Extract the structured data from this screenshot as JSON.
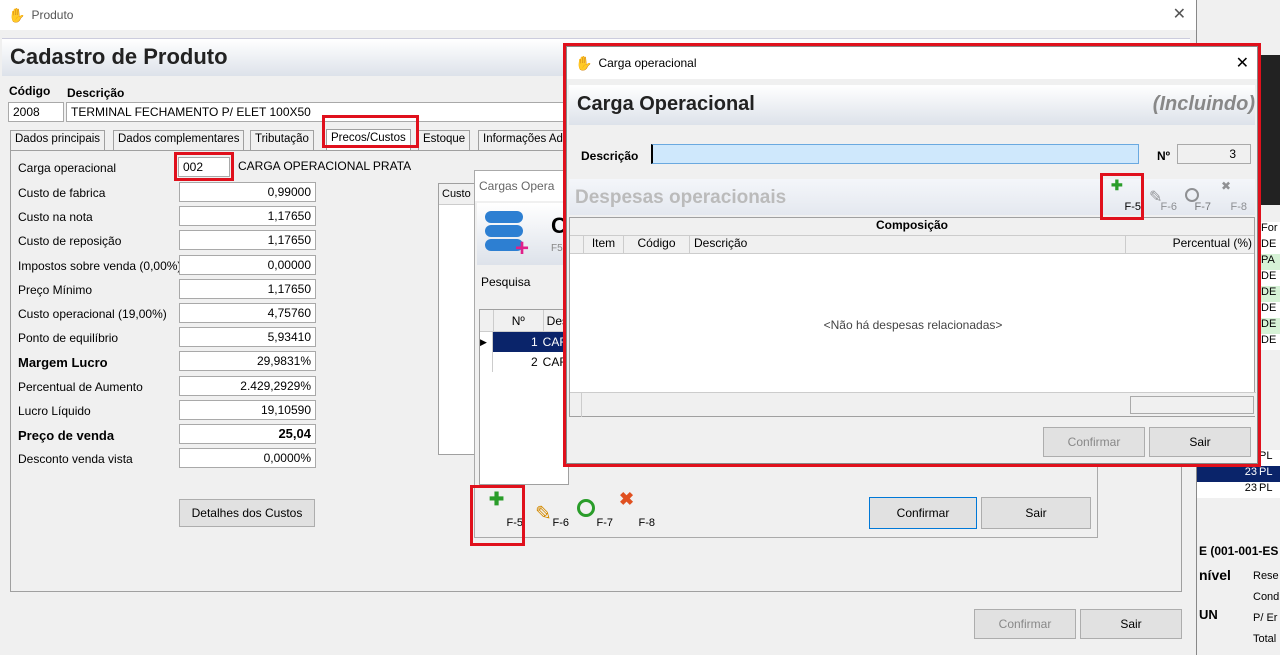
{
  "main": {
    "window_title": "Produto",
    "header": "Cadastro de Produto",
    "codigo_label": "Código",
    "descricao_label": "Descrição",
    "codigo": "2008",
    "descricao": "TERMINAL FECHAMENTO P/ ELET 100X50",
    "tabs": [
      "Dados principais",
      "Dados complementares",
      "Tributação",
      "Precos/Custos",
      "Estoque",
      "Informações Ad"
    ],
    "carga_label": "Carga operacional",
    "carga_code": "002",
    "carga_name": "CARGA OPERACIONAL PRATA",
    "rows": [
      {
        "label": "Custo de fabrica",
        "value": "0,99000"
      },
      {
        "label": "Custo na nota",
        "value": "1,17650"
      },
      {
        "label": "Custo de reposição",
        "value": "1,17650"
      },
      {
        "label": "Impostos sobre venda (0,00%)",
        "value": "0,00000"
      },
      {
        "label": "Preço Mínimo",
        "value": "1,17650"
      },
      {
        "label": "Custo operacional (19,00%)",
        "value": "4,75760"
      },
      {
        "label": "Ponto de equilíbrio",
        "value": "5,93410"
      },
      {
        "label": "Margem Lucro",
        "value": "29,9831%"
      },
      {
        "label": "Percentual de Aumento",
        "value": "2.429,2929%"
      },
      {
        "label": "Lucro Líquido",
        "value": "19,10590"
      },
      {
        "label": "Preço de venda",
        "value": "25,04"
      },
      {
        "label": "Desconto venda vista",
        "value": "0,0000%"
      }
    ],
    "detalhes_button": "Detalhes dos Custos",
    "confirmar": "Confirmar",
    "sair": "Sair"
  },
  "cargas": {
    "title": "Cargas Opera",
    "header_letter": "C",
    "f5_hint": "F5",
    "custo_col": "Custo",
    "pesquisa_label": "Pesquisa",
    "columns": [
      "Nº",
      "Des"
    ],
    "rows": [
      {
        "n": "1",
        "d": "CAR"
      },
      {
        "n": "2",
        "d": "CAR"
      }
    ],
    "toolbar": {
      "f5": "F-5",
      "f6": "F-6",
      "f7": "F-7",
      "f8": "F-8"
    },
    "confirmar": "Confirmar",
    "sair": "Sair"
  },
  "dialog": {
    "window_title": "Carga operacional",
    "header": "Carga Operacional",
    "mode": "(Incluindo)",
    "descricao_label": "Descrição",
    "descricao_value": "",
    "n_label": "Nº",
    "n_value": "3",
    "despesas_label": "Despesas operacionais",
    "toolbar": {
      "f5": "F-5",
      "f6": "F-6",
      "f7": "F-7",
      "f8": "F-8"
    },
    "composicao": "Composição",
    "columns": [
      "Item",
      "Código",
      "Descrição",
      "Percentual (%)"
    ],
    "empty_message": "<Não há despesas relacionadas>",
    "confirmar": "Confirmar",
    "sair": "Sair"
  },
  "background": {
    "list_prefix": [
      "For",
      "DE",
      "PA",
      "DE",
      "DE",
      "DE",
      "DE",
      "DE"
    ],
    "list_rows": [
      {
        "n": "",
        "t": "PL"
      },
      {
        "n": "23",
        "t": "PL"
      },
      {
        "n": "23",
        "t": "PL"
      }
    ],
    "footer_title": "E (001-001-ES",
    "nivel": "nível",
    "un": "UN",
    "right_labels": [
      "Rese",
      "Cond",
      "P/ Er",
      "Total"
    ]
  }
}
